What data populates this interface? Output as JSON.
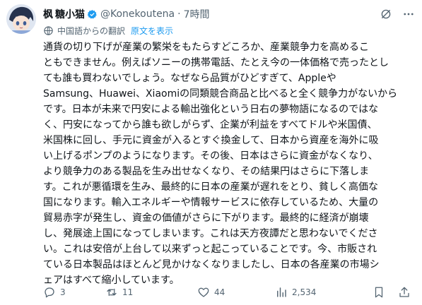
{
  "author": {
    "name": "糖小猫",
    "handle": "@Konekoutena",
    "time": "7時間",
    "name_prefix": "枫"
  },
  "translation": {
    "label": "中国語からの翻訳",
    "show_original": "原文を表示"
  },
  "post": {
    "text": "通貨の切り下げが産業の繁栄をもたらすどころか、産業競争力を高めるこ\nともできません。例えばソニーの携帯電話、たとえ今の一体価格で売ったとし\nても誰も買わないでしょう。なぜなら品質がひどすぎて、Appleや\nSamsung、Huawei、Xiaomiの同類競合商品と比べると全く競争力がないから\nです。日本が未来で円安による輸出強化という日右の夢物語になるのではな\nく、円安になってから誰も欲しがらず、企業が利益をすべてドルや米国債、\n米国株に回し、手元に資金が入るとすぐ換金して、日本から資産を海外に吸\nい上げるポンプのようになります。その後、日本はさらに資金がなくなり、\nより競争力のある製品を生み出せなくなり、その結果円はさらに下落しま\nす。これが悪循環を生み、最終的に日本の産業が遅れをとり、貧しく高価な\n国になります。輸入エネルギーや情報サービスに依存しているため、大量の\n貿易赤字が発生し、資金の価値がさらに下がります。最終的に経済が崩壊\nし、発展途上国になってしまいます。これは天方夜譚だと思わないでくださ\nい。これは安倍が上台して以来ずっと起こっていることです。今、市販され\nている日本製品はほとんど見かけなくなりましたし、日本の各産業の市場シ\nェアはすべて縮小しています。"
  },
  "actions": {
    "replies": "3",
    "reposts": "11",
    "likes": "44",
    "views": "2,534"
  },
  "colors": {
    "text": "#0f1419",
    "muted": "#536471",
    "accent": "#1d9bf0"
  },
  "icons": [
    "avatar",
    "verified-badge-icon",
    "grok-icon",
    "more-icon",
    "translate-icon",
    "reply-icon",
    "repost-icon",
    "like-icon",
    "views-icon",
    "bookmark-icon",
    "share-icon"
  ]
}
